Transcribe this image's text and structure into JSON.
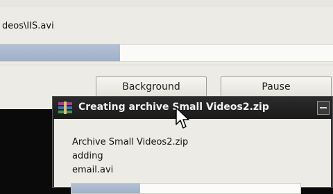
{
  "background_dialog": {
    "file_path": "deos\\IIS.avi",
    "progress": 0.36,
    "buttons": {
      "background_label": "Background",
      "pause_label": "Pause"
    }
  },
  "foreground_dialog": {
    "title": "Creating archive Small Videos2.zip",
    "icon": "winrar-archive-icon",
    "archive_line": "Archive Small Videos2.zip",
    "action_line": "adding",
    "file_line": "email.avi",
    "progress": 0.3
  },
  "colors": {
    "progress_fill": "#a7b6cd",
    "title_bar": "#1f1f1f"
  }
}
